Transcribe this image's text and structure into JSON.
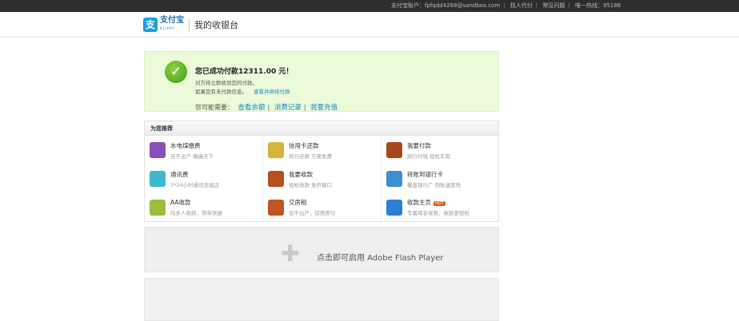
{
  "topbar": {
    "account": "支付宝账户：fpfqdd4268@sandbox.com",
    "links": [
      "找人代付",
      "常见问题",
      "唯一热线：95188"
    ]
  },
  "header": {
    "logo_text": "支付宝",
    "logo_sub": "ALIPAY",
    "title": "我的收银台"
  },
  "success": {
    "title": "您已成功付款12311.00 元！",
    "line1": "对方将立即收到您的付款。",
    "line2": "如果您有未付款信息。",
    "line2_link": "查看并继续付款",
    "needs_label": "您可能需要：",
    "links": [
      "查看余额",
      "消费记录",
      "我要充值"
    ]
  },
  "recommend": {
    "title": "为您推荐",
    "items": [
      {
        "name": "水电煤缴费",
        "desc": "足不出户 缴遍天下",
        "color": "#8a4fb8",
        "icon": "utilities-icon"
      },
      {
        "name": "信用卡还款",
        "desc": "跨行还款 方便免费",
        "color": "#d6b437",
        "icon": "credit-card-icon"
      },
      {
        "name": "我要付款",
        "desc": "跨行付钱 轻松实现",
        "color": "#a9461c",
        "icon": "pay-icon"
      },
      {
        "name": "通讯费",
        "desc": "7*24小时通讯充值店",
        "color": "#3fb8cf",
        "icon": "phone-bill-icon"
      },
      {
        "name": "我要收款",
        "desc": "轻松收款 免开窗口",
        "color": "#b5501f",
        "icon": "receive-icon"
      },
      {
        "name": "转账到银行卡",
        "desc": "覆盖银行广 到账速度快",
        "color": "#3d8fd0",
        "icon": "bank-transfer-icon"
      },
      {
        "name": "AA收款",
        "desc": "向多人收款，简单快捷",
        "color": "#9cbc3b",
        "icon": "aa-icon"
      },
      {
        "name": "交房租",
        "desc": "足不出户，房租即付",
        "color": "#c0561f",
        "icon": "rent-icon"
      },
      {
        "name": "收款主页",
        "desc": "专属域名收款，收款更轻松",
        "color": "#2a7fd4",
        "icon": "homepage-icon",
        "badge": "HOT"
      }
    ]
  },
  "flash": {
    "text": "点击即可启用 Adobe Flash Player"
  }
}
